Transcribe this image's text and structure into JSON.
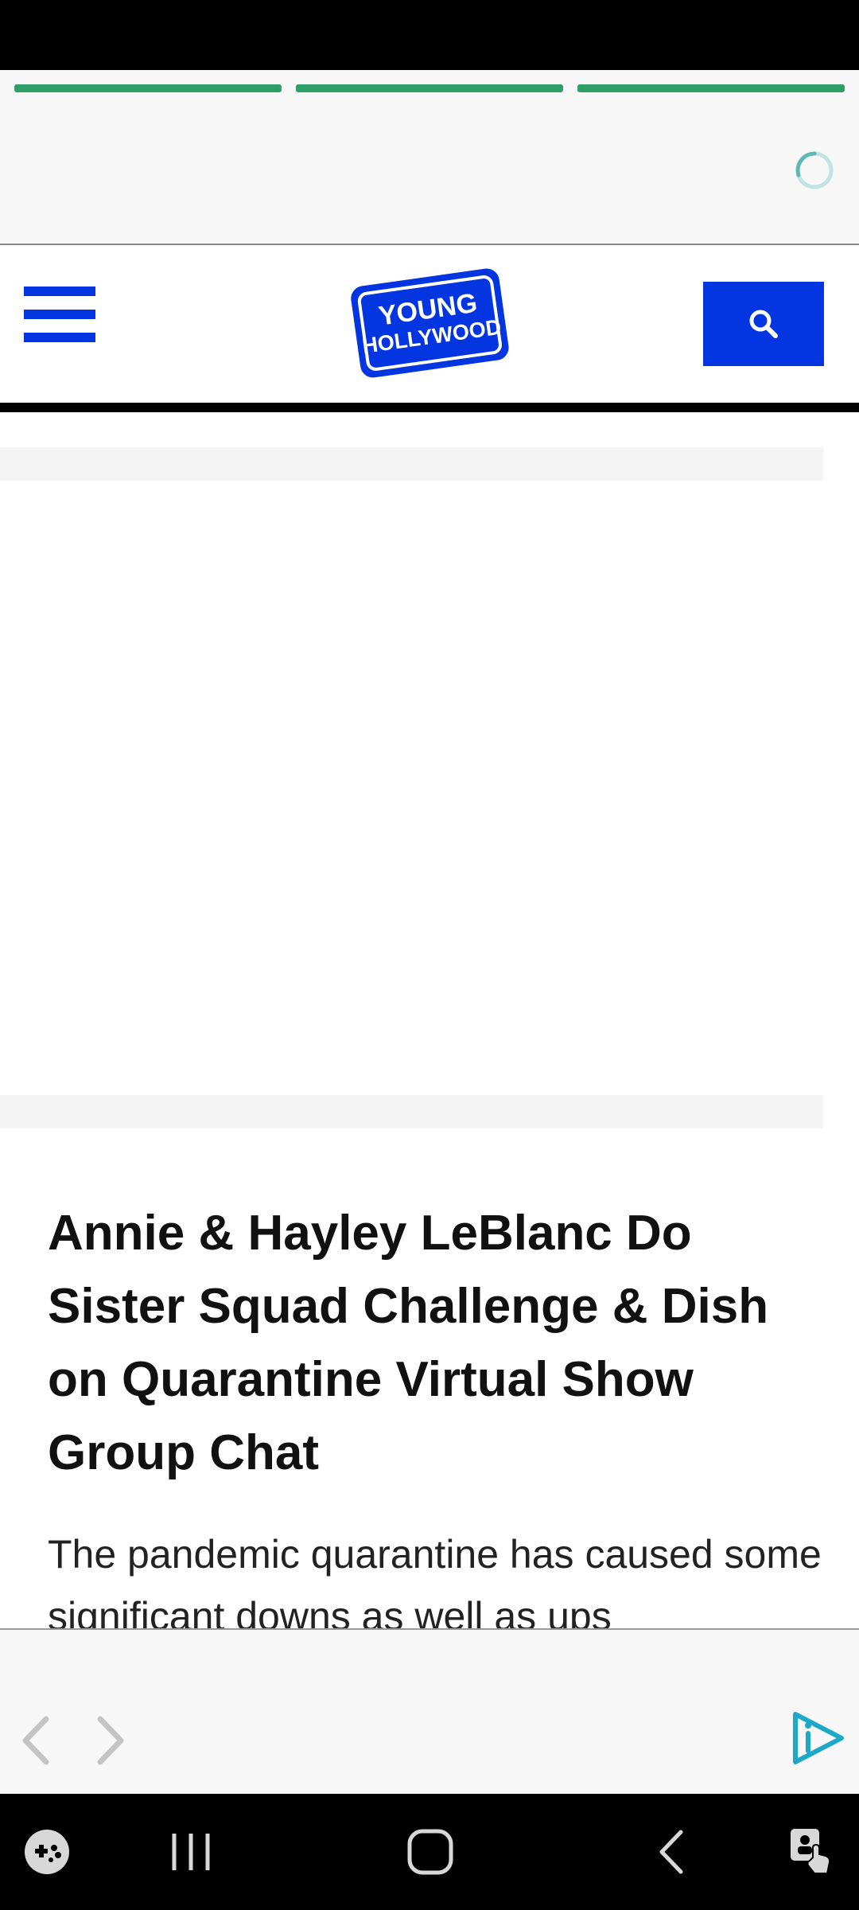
{
  "story": {
    "progress": [
      1.0,
      1.0,
      1.0
    ],
    "accent_color": "#2e9e67",
    "loading": true
  },
  "site": {
    "brand_color": "#0335e0",
    "logo_line1": "YOUNG",
    "logo_line2": "HOLLYWOOD",
    "menu_icon": "hamburger-menu-icon",
    "search_icon": "search-icon"
  },
  "article": {
    "title": "Annie & Hayley LeBlanc Do Sister Squad Challenge & Dish on Quarantine Virtual Show Group Chat",
    "body": "The pandemic quarantine has caused some significant downs as well as ups"
  },
  "footer": {
    "prev_icon": "chevron-left-icon",
    "next_icon": "chevron-right-icon",
    "brand_icon": "play-info-icon",
    "brand_color": "#1ea8c8"
  },
  "system_nav": {
    "game_icon": "game-launcher-icon",
    "recents_icon": "recent-apps-icon",
    "home_icon": "home-icon",
    "back_icon": "back-icon",
    "accessibility_icon": "accessibility-icon"
  }
}
